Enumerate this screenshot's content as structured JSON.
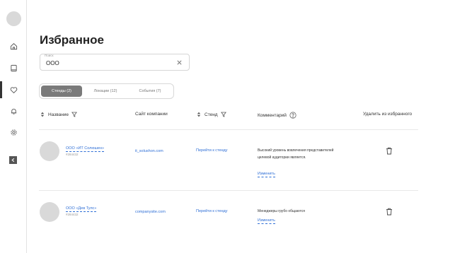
{
  "sidebar": {
    "items": [
      {
        "icon": "home-icon",
        "active": false
      },
      {
        "icon": "book-icon",
        "active": false
      },
      {
        "icon": "heart-icon",
        "active": true
      },
      {
        "icon": "bell-icon",
        "active": false
      },
      {
        "icon": "gear-icon",
        "active": false
      }
    ],
    "collapse_icon": "chevron-left-icon"
  },
  "page": {
    "title": "Избранное"
  },
  "search": {
    "label": "Поиск",
    "value": "ООО"
  },
  "tabs": [
    {
      "label": "Стенды (2)",
      "active": true
    },
    {
      "label": "Локации (12)",
      "active": false
    },
    {
      "label": "События (7)",
      "active": false
    }
  ],
  "table": {
    "headers": {
      "name": "Название",
      "site": "Сайт компании",
      "stand": "Стенд",
      "comment": "Комментарий",
      "delete": "Удалить из избранного"
    },
    "rows": [
      {
        "name": "ООО «ИТ Солюшен»",
        "id": "#284432",
        "site": "it_solushon.com",
        "stand_link": "Перейти к стенду",
        "comment": "Высокий уровень вовлечения представителей целевой аудитории является.",
        "edit": "Изменить"
      },
      {
        "name": "ООО «Дев Тулс»",
        "id": "#284432",
        "site": "companysite.com",
        "stand_link": "Перейти к стенду",
        "comment": "Менеджеры грубо общаются",
        "edit": "Изменить"
      }
    ]
  },
  "colors": {
    "link": "#2f6fd6",
    "active_tab": "#7a7a7a",
    "placeholder": "#d9d9d9"
  }
}
